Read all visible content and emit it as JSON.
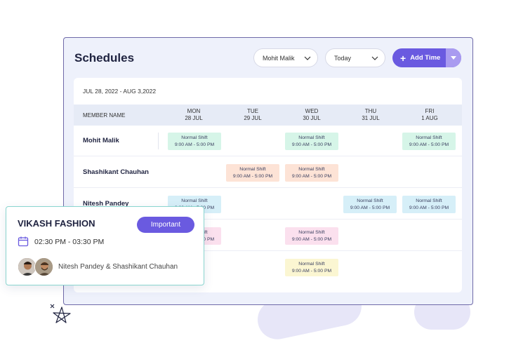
{
  "header": {
    "title": "Schedules",
    "member_select": "Mohit Malik",
    "period_select": "Today",
    "add_button": "Add Time"
  },
  "table": {
    "date_range": "JUL 28, 2022 - AUG 3,2022",
    "member_col": "MEMBER NAME",
    "days": [
      {
        "name": "MON",
        "date": "28 JUL"
      },
      {
        "name": "TUE",
        "date": "29 JUL"
      },
      {
        "name": "WED",
        "date": "30 JUL"
      },
      {
        "name": "THU",
        "date": "31 JUL"
      },
      {
        "name": "FRI",
        "date": "1 AUG"
      }
    ],
    "rows": [
      {
        "name": "Mohit Malik"
      },
      {
        "name": "Shashikant Chauhan"
      },
      {
        "name": "Nitesh Pandey"
      },
      {
        "name": ""
      },
      {
        "name": ""
      }
    ],
    "shift_label": "Normal Shift",
    "shift_time": "9:00 AM - 5:00 PM"
  },
  "popup": {
    "title": "VIKASH FASHION",
    "badge": "Important",
    "time": "02:30 PM - 03:30 PM",
    "people": "Nitesh Pandey & Shashikant Chauhan"
  },
  "colors": {
    "accent": "#6a5ae0",
    "green": "#d6f5e8",
    "peach": "#fde3d6",
    "blue": "#d6eff8",
    "pink": "#fbe0ee",
    "yellow": "#fbf6d2"
  }
}
